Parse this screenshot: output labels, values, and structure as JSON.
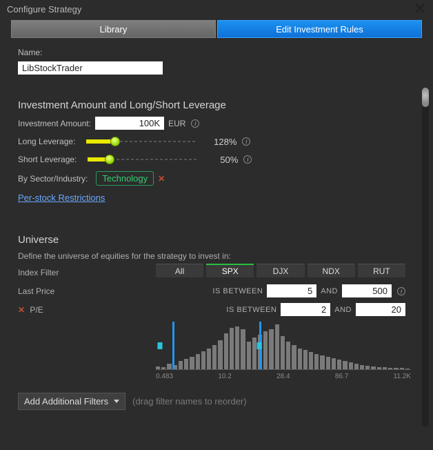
{
  "title": "Configure Strategy",
  "tabs": {
    "library": "Library",
    "edit": "Edit Investment Rules"
  },
  "name": {
    "label": "Name:",
    "value": "LibStockTrader"
  },
  "leverage": {
    "heading": "Investment Amount and Long/Short Leverage",
    "amount_label": "Investment Amount:",
    "amount_value": "100K",
    "currency": "EUR",
    "long_label": "Long Leverage:",
    "long_pct": "128%",
    "long_fill": 26,
    "short_label": "Short Leverage:",
    "short_pct": "50%",
    "short_fill": 20,
    "sector_label": "By Sector/Industry:",
    "sector_tag": "Technology",
    "per_stock_link": "Per-stock Restrictions"
  },
  "universe": {
    "heading": "Universe",
    "subtitle": "Define the universe of equities for the strategy to invest in:",
    "index_label": "Index Filter",
    "tabs": [
      "All",
      "SPX",
      "DJX",
      "NDX",
      "RUT"
    ],
    "active_tab": "SPX",
    "last_price": {
      "label": "Last Price",
      "op": "IS BETWEEN",
      "min": "5",
      "and": "AND",
      "max": "500"
    },
    "pe": {
      "label": "P/E",
      "op": "IS BETWEEN",
      "min": "2",
      "and": "AND",
      "max": "20"
    },
    "xticks": [
      "0.483",
      "10.2",
      "28.4",
      "86.7",
      "11.2K"
    ]
  },
  "addfilter": {
    "label": "Add Additional Filters",
    "hint": "(drag filter names to reorder)"
  },
  "chart_data": {
    "type": "bar",
    "title": "P/E distribution",
    "xlabel": "P/E",
    "xticks": [
      0.483,
      10.2,
      28.4,
      86.7,
      11200
    ],
    "selected_range": [
      2,
      20
    ],
    "values": [
      4,
      3,
      8,
      6,
      12,
      15,
      18,
      22,
      26,
      30,
      35,
      42,
      52,
      60,
      62,
      58,
      40,
      46,
      50,
      55,
      58,
      65,
      48,
      40,
      35,
      30,
      28,
      25,
      22,
      20,
      18,
      16,
      14,
      12,
      10,
      8,
      6,
      5,
      4,
      3,
      3,
      2,
      2,
      2,
      1
    ]
  }
}
